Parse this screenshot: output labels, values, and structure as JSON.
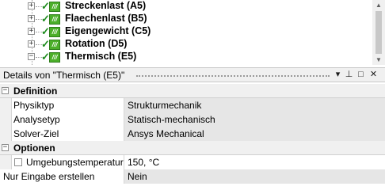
{
  "tree": {
    "items": [
      {
        "label": "Streckenlast (A5)",
        "expander": "+"
      },
      {
        "label": "Flaechenlast (B5)",
        "expander": "+"
      },
      {
        "label": "Eigengewicht (C5)",
        "expander": "+"
      },
      {
        "label": "Rotation (D5)",
        "expander": "+"
      },
      {
        "label": "Thermisch (E5)",
        "expander": "−"
      }
    ]
  },
  "details": {
    "title": "Details von \"Thermisch (E5)\"",
    "buttons": {
      "dropdown": "▾",
      "pin": "⊥",
      "maximize": "□",
      "close": "✕"
    }
  },
  "sections": [
    {
      "label": "Definition",
      "toggle": "−",
      "properties": [
        {
          "name": "Physiktyp",
          "value": "Strukturmechanik"
        },
        {
          "name": "Analysetyp",
          "value": "Statisch-mechanisch"
        },
        {
          "name": "Solver-Ziel",
          "value": "Ansys Mechanical"
        }
      ]
    },
    {
      "label": "Optionen",
      "toggle": "−",
      "properties": [
        {
          "name": "Umgebungstemperatur",
          "value": "150, °C"
        }
      ]
    }
  ],
  "extra_property": {
    "name": "Nur Eingabe erstellen",
    "value": "Nein"
  },
  "colors": {
    "load_icon": "#4caf2a",
    "check": "#1f8c1f",
    "readonly_bg": "#e6e6e6"
  }
}
